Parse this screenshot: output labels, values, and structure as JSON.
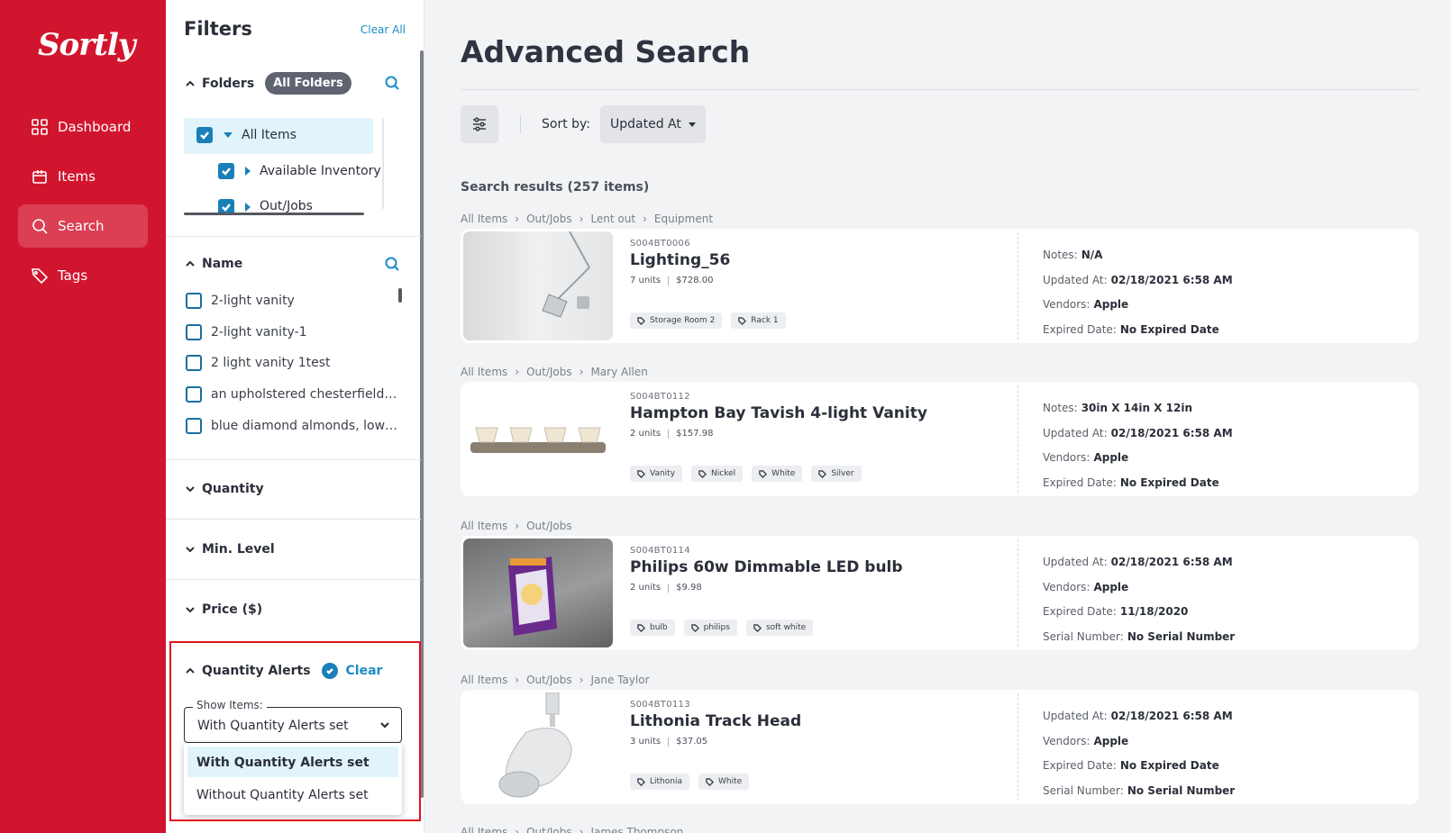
{
  "app": {
    "logo": "Sortly"
  },
  "sidebar": {
    "items": [
      {
        "label": "Dashboard",
        "icon": "dashboard-icon"
      },
      {
        "label": "Items",
        "icon": "items-icon"
      },
      {
        "label": "Search",
        "icon": "search-icon",
        "active": true
      },
      {
        "label": "Tags",
        "icon": "tags-icon"
      }
    ]
  },
  "filters": {
    "title": "Filters",
    "clear_all": "Clear All",
    "folders": {
      "label": "Folders",
      "pill": "All Folders",
      "tree": [
        {
          "label": "All Items",
          "checked": true
        },
        {
          "label": "Available Inventory",
          "checked": true
        },
        {
          "label": "Out/Jobs",
          "checked": true
        }
      ]
    },
    "name": {
      "label": "Name",
      "options": [
        "2-light vanity",
        "2-light vanity-1",
        "2 light vanity 1test",
        "an upholstered chesterfield sofa",
        "blue diamond almonds, low sodium"
      ]
    },
    "quantity": "Quantity",
    "min_level": "Min. Level",
    "price": "Price ($)",
    "quantity_alerts": {
      "label": "Quantity Alerts",
      "clear": "Clear",
      "show_items_label": "Show Items:",
      "selected": "With Quantity Alerts set",
      "options": [
        "With Quantity Alerts set",
        "Without Quantity Alerts set"
      ]
    }
  },
  "main": {
    "title": "Advanced Search",
    "sort_label": "Sort by:",
    "sort_value": "Updated At",
    "results_count": "Search results (257 items)",
    "results": [
      {
        "breadcrumb": [
          "All Items",
          "Out/Jobs",
          "Lent out",
          "Equipment"
        ],
        "sku": "S004BT0006",
        "name": "Lighting_56",
        "units": "7 units",
        "price": "$728.00",
        "tags": [
          "Storage Room 2",
          "Rack 1"
        ],
        "details": [
          {
            "label": "Notes:",
            "value": "N/A"
          },
          {
            "label": "Updated At:",
            "value": "02/18/2021 6:58 AM"
          },
          {
            "label": "Vendors:",
            "value": "Apple"
          },
          {
            "label": "Expired Date:",
            "value": "No Expired Date"
          }
        ]
      },
      {
        "breadcrumb": [
          "All Items",
          "Out/Jobs",
          "Mary Allen"
        ],
        "sku": "S004BT0112",
        "name": "Hampton Bay Tavish 4-light Vanity",
        "units": "2 units",
        "price": "$157.98",
        "tags": [
          "Vanity",
          "Nickel",
          "White",
          "Silver"
        ],
        "details": [
          {
            "label": "Notes:",
            "value": "30in X 14in X 12in"
          },
          {
            "label": "Updated At:",
            "value": "02/18/2021 6:58 AM"
          },
          {
            "label": "Vendors:",
            "value": "Apple"
          },
          {
            "label": "Expired Date:",
            "value": "No Expired Date"
          }
        ]
      },
      {
        "breadcrumb": [
          "All Items",
          "Out/Jobs"
        ],
        "sku": "S004BT0114",
        "name": "Philips 60w Dimmable LED bulb",
        "units": "2 units",
        "price": "$9.98",
        "tags": [
          "bulb",
          "philips",
          "soft white"
        ],
        "details": [
          {
            "label": "Updated At:",
            "value": "02/18/2021 6:58 AM"
          },
          {
            "label": "Vendors:",
            "value": "Apple"
          },
          {
            "label": "Expired Date:",
            "value": "11/18/2020"
          },
          {
            "label": "Serial Number:",
            "value": "No Serial Number"
          }
        ]
      },
      {
        "breadcrumb": [
          "All Items",
          "Out/Jobs",
          "Jane Taylor"
        ],
        "sku": "S004BT0113",
        "name": "Lithonia Track Head",
        "units": "3 units",
        "price": "$37.05",
        "tags": [
          "Lithonia",
          "White"
        ],
        "details": [
          {
            "label": "Updated At:",
            "value": "02/18/2021 6:58 AM"
          },
          {
            "label": "Vendors:",
            "value": "Apple"
          },
          {
            "label": "Expired Date:",
            "value": "No Expired Date"
          },
          {
            "label": "Serial Number:",
            "value": "No Serial Number"
          }
        ]
      },
      {
        "breadcrumb": [
          "All Items",
          "Out/Jobs",
          "James Thompson"
        ]
      }
    ]
  }
}
